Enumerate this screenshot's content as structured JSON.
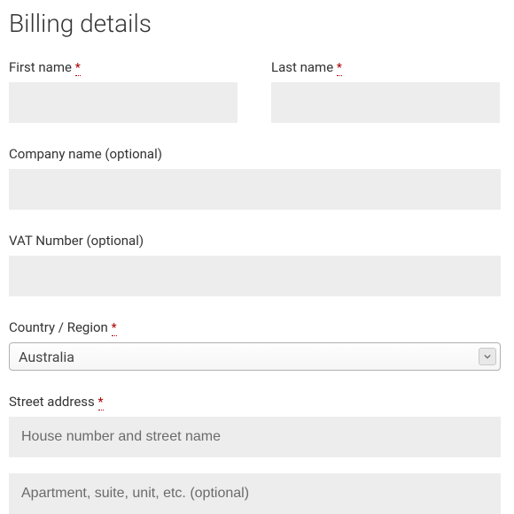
{
  "heading": "Billing details",
  "required_mark": "*",
  "fields": {
    "first_name": {
      "label": "First name",
      "value": ""
    },
    "last_name": {
      "label": "Last name",
      "value": ""
    },
    "company": {
      "label": "Company name (optional)",
      "value": ""
    },
    "vat": {
      "label": "VAT Number (optional)",
      "value": ""
    },
    "country": {
      "label": "Country / Region",
      "value": "Australia"
    },
    "street": {
      "label": "Street address",
      "placeholder1": "House number and street name",
      "placeholder2": "Apartment, suite, unit, etc. (optional)"
    }
  }
}
